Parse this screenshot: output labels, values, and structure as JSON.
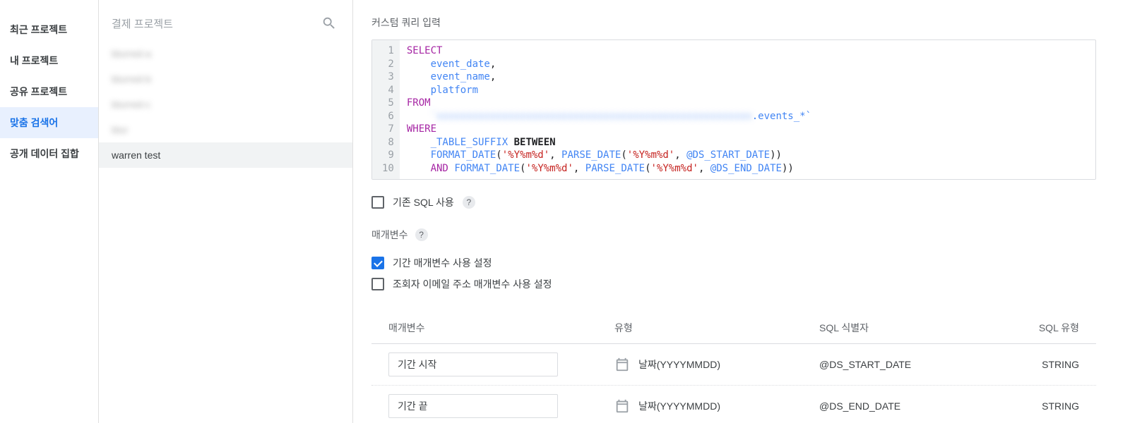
{
  "nav": {
    "items": [
      {
        "label": "최근 프로젝트"
      },
      {
        "label": "내 프로젝트"
      },
      {
        "label": "공유 프로젝트"
      },
      {
        "label": "맞춤 검색어"
      },
      {
        "label": "공개 데이터 집합"
      }
    ],
    "activeIndex": 3
  },
  "projects": {
    "searchPlaceholder": "결제 프로젝트",
    "items": [
      {
        "label": "blurred-a"
      },
      {
        "label": "blurred-b"
      },
      {
        "label": "blurred-c"
      },
      {
        "label": "blur"
      },
      {
        "label": "warren test"
      }
    ],
    "selectedIndex": 4
  },
  "query": {
    "title": "커스텀 쿼리 입력",
    "lines": {
      "l1": "SELECT",
      "l2a": "    ",
      "l2b": "event_date",
      "l2c": ",",
      "l3a": "    ",
      "l3b": "event_name",
      "l3c": ",",
      "l4a": "    ",
      "l4b": "platform",
      "l5": "FROM",
      "l6a": "    ",
      "l6b_blur": "`xxxxxxxxxxxxxxxxxxxxxxxxxxxxxxxxxxxxxxxxxxxxxxxxxxxxx",
      "l6c": ".events_*`",
      "l7": "WHERE",
      "l8a": "    ",
      "l8b": "_TABLE_SUFFIX",
      "l8c": " ",
      "l8d": "BETWEEN",
      "l9a": "    ",
      "l9b": "FORMAT_DATE",
      "l9c": "(",
      "l9d": "'%Y%m%d'",
      "l9e": ", ",
      "l9f": "PARSE_DATE",
      "l9g": "(",
      "l9h": "'%Y%m%d'",
      "l9i": ", ",
      "l9j": "@DS_START_DATE",
      "l9k": "))",
      "l10a": "    ",
      "l10b": "AND",
      "l10c": " ",
      "l10d": "FORMAT_DATE",
      "l10e": "(",
      "l10f": "'%Y%m%d'",
      "l10g": ", ",
      "l10h": "PARSE_DATE",
      "l10i": "(",
      "l10j": "'%Y%m%d'",
      "l10k": ", ",
      "l10l": "@DS_END_DATE",
      "l10m": "))"
    },
    "gutter": [
      "1",
      "2",
      "3",
      "4",
      "5",
      "6",
      "7",
      "8",
      "9",
      "10"
    ]
  },
  "options": {
    "legacySql": "기존 SQL 사용",
    "paramsHeading": "매개변수",
    "dateRangeParam": "기간 매개변수 사용 설정",
    "viewerEmailParam": "조회자 이메일 주소 매개변수 사용 설정",
    "dateRangeChecked": true,
    "viewerEmailChecked": false,
    "legacyChecked": false
  },
  "paramTable": {
    "headers": {
      "name": "매개변수",
      "type": "유형",
      "sqlId": "SQL 식별자",
      "sqlType": "SQL 유형"
    },
    "rows": [
      {
        "name": "기간 시작",
        "type": "날짜(YYYYMMDD)",
        "sqlId": "@DS_START_DATE",
        "sqlType": "STRING"
      },
      {
        "name": "기간 끝",
        "type": "날짜(YYYYMMDD)",
        "sqlId": "@DS_END_DATE",
        "sqlType": "STRING"
      }
    ]
  }
}
